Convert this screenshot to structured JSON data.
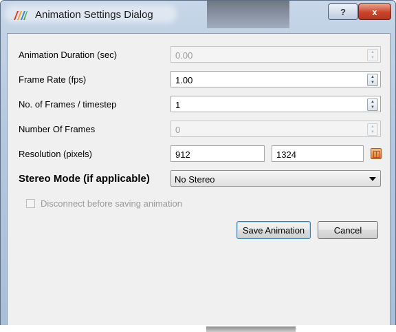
{
  "window": {
    "title": "Animation Settings Dialog",
    "help_label": "?",
    "close_label": "x"
  },
  "form": {
    "duration": {
      "label": "Animation Duration (sec)",
      "value": "0.00",
      "enabled": false
    },
    "frame_rate": {
      "label": "Frame Rate (fps)",
      "value": "1.00",
      "enabled": true
    },
    "frames_per_timestep": {
      "label": "No. of Frames / timestep",
      "value": "1",
      "enabled": true
    },
    "number_of_frames": {
      "label": "Number Of Frames",
      "value": "0",
      "enabled": false
    },
    "resolution": {
      "label": "Resolution (pixels)",
      "width": "912",
      "height": "1324"
    },
    "stereo_mode": {
      "label": "Stereo Mode (if applicable)",
      "selected": "No Stereo"
    },
    "disconnect": {
      "label": "Disconnect before saving animation",
      "checked": false,
      "enabled": false
    }
  },
  "buttons": {
    "save": "Save Animation",
    "cancel": "Cancel"
  },
  "colors": {
    "close_button": "#c8442b",
    "default_button_border": "#3c7fb1"
  },
  "icons": {
    "app": "paraview-icon",
    "lock_aspect": "lock-aspect-icon"
  }
}
